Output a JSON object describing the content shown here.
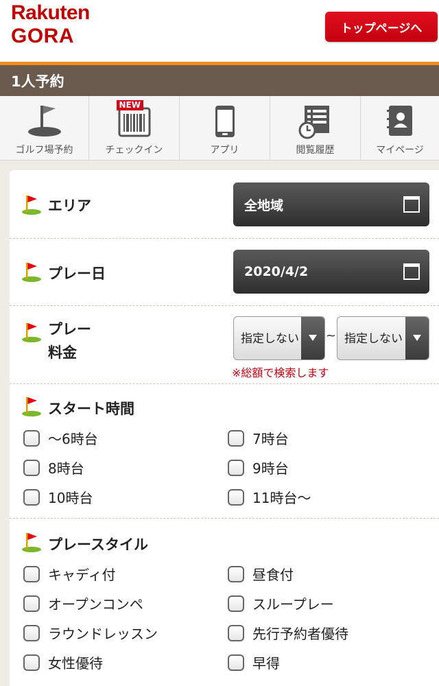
{
  "header": {
    "logo_line1": "Rakuten",
    "logo_line2": "GORA",
    "top_button": "トップページへ"
  },
  "page_title": "1人予約",
  "nav": [
    {
      "label": "ゴルフ場予約",
      "icon": "golf-flag-icon"
    },
    {
      "label": "チェックイン",
      "icon": "barcode-icon",
      "badge": "NEW"
    },
    {
      "label": "アプリ",
      "icon": "smartphone-icon"
    },
    {
      "label": "閲覧履歴",
      "icon": "history-icon"
    },
    {
      "label": "マイページ",
      "icon": "profile-book-icon"
    }
  ],
  "form": {
    "area": {
      "label": "エリア",
      "value": "全地域"
    },
    "play_date": {
      "label": "プレー日",
      "value": "2020/4/2"
    },
    "fee": {
      "label_line1": "プレー",
      "label_line2": "料金",
      "min_value": "指定しない",
      "max_value": "指定しない",
      "separator": "~",
      "note": "※総額で検索します"
    },
    "start_time": {
      "label": "スタート時間",
      "options": [
        "～6時台",
        "7時台",
        "8時台",
        "9時台",
        "10時台",
        "11時台～"
      ]
    },
    "play_style": {
      "label": "プレースタイル",
      "options": [
        "キャディ付",
        "昼食付",
        "オープンコンペ",
        "スループレー",
        "ラウンドレッスン",
        "先行予約者優待",
        "女性優待",
        "早得"
      ]
    }
  },
  "colors": {
    "brand_red": "#bf0000",
    "accent_orange": "#f28c1e",
    "title_bar": "#6b5a4e",
    "note_red": "#c0000f"
  }
}
